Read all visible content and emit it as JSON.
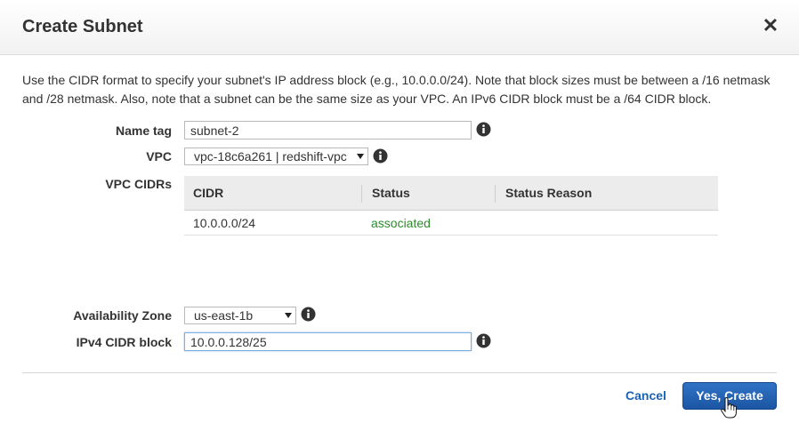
{
  "dialog": {
    "title": "Create Subnet",
    "description": "Use the CIDR format to specify your subnet's IP address block (e.g., 10.0.0.0/24). Note that block sizes must be between a /16 netmask and /28 netmask. Also, note that a subnet can be the same size as your VPC. An IPv6 CIDR block must be a /64 CIDR block."
  },
  "form": {
    "name_tag": {
      "label": "Name tag",
      "value": "subnet-2"
    },
    "vpc": {
      "label": "VPC",
      "selected": "vpc-18c6a261 | redshift-vpc"
    },
    "vpc_cidrs": {
      "label": "VPC CIDRs",
      "columns": [
        "CIDR",
        "Status",
        "Status Reason"
      ],
      "rows": [
        {
          "cidr": "10.0.0.0/24",
          "status": "associated",
          "status_reason": ""
        }
      ]
    },
    "availability_zone": {
      "label": "Availability Zone",
      "selected": "us-east-1b"
    },
    "ipv4_cidr_block": {
      "label": "IPv4 CIDR block",
      "value": "10.0.0.128/25"
    }
  },
  "footer": {
    "cancel_label": "Cancel",
    "primary_label": "Yes, Create"
  },
  "icons": {
    "close": "close-icon",
    "info": "info-icon",
    "caret": "chevron-down-icon",
    "cursor": "hand-pointer-icon"
  },
  "colors": {
    "primary_button": "#1b55a3",
    "link": "#1a63b3",
    "status_associated": "#2e8b2e"
  }
}
